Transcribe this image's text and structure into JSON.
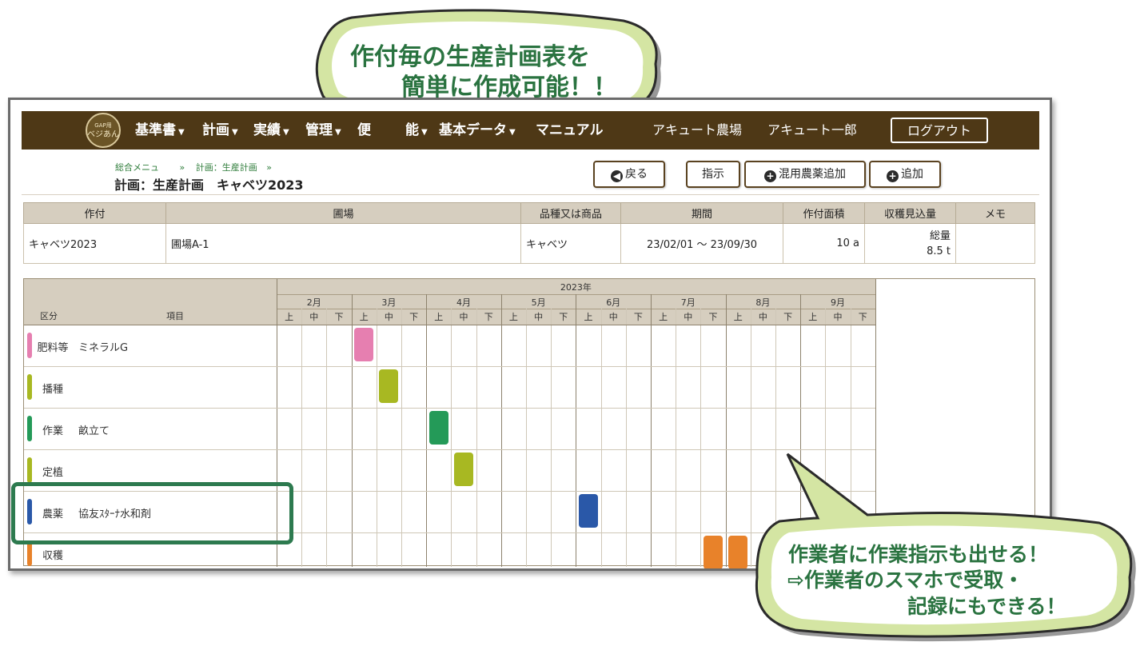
{
  "bubble_top": {
    "line1": "作付毎の生産計画表を",
    "line2": "簡単に作成可能！！"
  },
  "bubble_bottom": {
    "line1": "作業者に作業指示も出せる！",
    "line2": "⇨作業者のスマホで受取・",
    "line3": "記録にもできる！"
  },
  "header": {
    "logo_line1": "GAP用",
    "logo_line2": "ベジあん",
    "nav": [
      {
        "label": "基準書"
      },
      {
        "label": "計画"
      },
      {
        "label": "実績"
      },
      {
        "label": "管理"
      },
      {
        "label": "便"
      },
      {
        "label": "能"
      },
      {
        "label": "基本データ"
      },
      {
        "label": "マニュアル"
      }
    ],
    "farm": "アキュート農場",
    "user": "アキュート一郎",
    "logout": "ログアウト"
  },
  "breadcrumb": {
    "item1": "総合メニュ",
    "sep": "»",
    "item2": "計画：生産計画"
  },
  "page_title": "計画：生産計画　キャベツ2023",
  "buttons": {
    "back": "戻る",
    "instruct": "指示",
    "add_mix": "混用農薬追加",
    "add": "追加"
  },
  "info_table": {
    "headers": [
      "作付",
      "圃場",
      "品種又は商品",
      "期間",
      "作付面積",
      "収穫見込量",
      "メモ"
    ],
    "row": {
      "crop": "キャベツ2023",
      "field": "圃場A-1",
      "variety": "キャベツ",
      "period": "23/02/01 ～ 23/09/30",
      "area": "10 a",
      "yield_label": "総量",
      "yield_value": "8.5 t",
      "memo": ""
    }
  },
  "gantt": {
    "year": "2023年",
    "col_category": "区分",
    "col_item": "項目",
    "months": [
      "2月",
      "3月",
      "4月",
      "5月",
      "6月",
      "7月",
      "8月",
      "9月"
    ],
    "thirds": [
      "上",
      "中",
      "下"
    ],
    "rows": [
      {
        "category": "肥料等",
        "item": "ミネラルG",
        "color": "#e67fb0",
        "slots": [
          3
        ]
      },
      {
        "category": "播種",
        "item": "",
        "color": "#a8b822",
        "slots": [
          4
        ]
      },
      {
        "category": "作業",
        "item": "畝立て",
        "color": "#249a58",
        "slots": [
          6
        ]
      },
      {
        "category": "定植",
        "item": "",
        "color": "#a8b822",
        "slots": [
          7
        ]
      },
      {
        "category": "農薬",
        "item": "協友ｽﾀｰﾅ水和剤",
        "color": "#2a58a8",
        "slots": [
          12
        ]
      },
      {
        "category": "収穫",
        "item": "",
        "color": "#e8822a",
        "slots": [
          17,
          18
        ]
      }
    ]
  }
}
